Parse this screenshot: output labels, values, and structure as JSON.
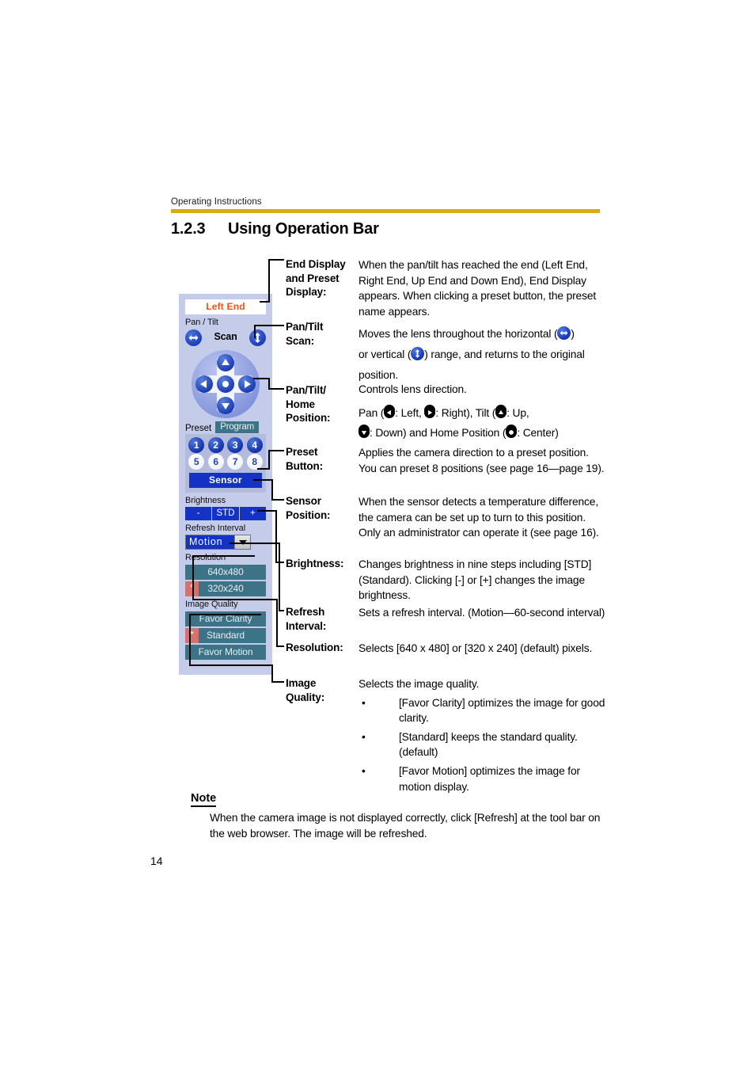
{
  "header": {
    "running_head": "Operating Instructions",
    "rule_color": "#dcaa09"
  },
  "section": {
    "number": "1.2.3",
    "title": "Using Operation Bar"
  },
  "operation_panel": {
    "end_display": {
      "value": "Left End",
      "text_color": "#e8541a"
    },
    "pan_tilt_label": "Pan / Tilt",
    "scan_label": "Scan",
    "scan_buttons": {
      "horizontal_icon": "horizontal-scan-icon",
      "vertical_icon": "vertical-scan-icon"
    },
    "dpad": {
      "up_icon": "arrow-up-icon",
      "down_icon": "arrow-down-icon",
      "left_icon": "arrow-left-icon",
      "right_icon": "arrow-right-icon",
      "home_icon": "home-center-icon"
    },
    "preset": {
      "label": "Preset",
      "program_label": "Program",
      "buttons": [
        {
          "label": "1",
          "state": "on"
        },
        {
          "label": "2",
          "state": "on"
        },
        {
          "label": "3",
          "state": "on"
        },
        {
          "label": "4",
          "state": "on"
        },
        {
          "label": "5",
          "state": "off"
        },
        {
          "label": "6",
          "state": "off"
        },
        {
          "label": "7",
          "state": "off"
        },
        {
          "label": "8",
          "state": "off"
        }
      ]
    },
    "sensor_label": "Sensor",
    "brightness": {
      "label": "Brightness",
      "minus": "-",
      "std": "STD",
      "plus": "+"
    },
    "refresh_interval": {
      "label": "Refresh Interval",
      "selected": "Motion",
      "dropdown_icon": "chevron-down-icon"
    },
    "resolution": {
      "label": "Resolution",
      "options": [
        {
          "label": "640x480",
          "selected": false
        },
        {
          "label": "320x240",
          "selected": true
        }
      ]
    },
    "image_quality": {
      "label": "Image Quality",
      "options": [
        {
          "label": "Favor Clarity",
          "selected": false
        },
        {
          "label": "Standard",
          "selected": true
        },
        {
          "label": "Favor Motion",
          "selected": false
        }
      ]
    },
    "selected_marker": "*",
    "colors": {
      "panel_bg": "#c5cce9",
      "button_blue": "#1433c4",
      "option_teal": "#3d7386",
      "marker_red": "#d4726d"
    }
  },
  "definitions": [
    {
      "term": "End Display and Preset Display:",
      "desc": "When the pan/tilt has reached the end (Left End, Right End, Up End and Down End), End Display appears. When clicking a preset button, the preset name appears."
    },
    {
      "term": "Pan/Tilt Scan:",
      "desc_part1": "Moves the lens throughout the horizontal (",
      "desc_part2": ")",
      "desc_part3": "or vertical (",
      "desc_part4": ") range, and returns to the original position."
    },
    {
      "term": "Pan/Tilt/ Home Position:",
      "line1": "Controls lens direction.",
      "line2_a": "Pan (",
      "line2_b": ": Left, ",
      "line2_c": ": Right), Tilt (",
      "line2_d": ": Up,",
      "line3_a": ": Down) and Home Position (",
      "line3_b": ": Center)"
    },
    {
      "term": "Preset Button:",
      "desc": "Applies the camera direction to a preset position. You can preset 8 positions (see page 16—page 19)."
    },
    {
      "term": "Sensor Position:",
      "desc": "When the sensor detects a temperature difference, the camera can be set up to turn to this position. Only an administrator can operate it (see page 16)."
    },
    {
      "term": "Brightness:",
      "desc": "Changes brightness in nine steps including [STD] (Standard). Clicking [-] or [+] changes the image brightness."
    },
    {
      "term": "Refresh Interval:",
      "desc": "Sets a refresh interval. (Motion—60-second interval)"
    },
    {
      "term": "Resolution:",
      "desc": "Selects [640 x 480] or [320 x 240] (default) pixels."
    },
    {
      "term": "Image Quality:",
      "desc": "Selects the image quality.",
      "bullets": [
        "[Favor Clarity] optimizes the image for good clarity.",
        "[Standard] keeps the standard quality. (default)",
        "[Favor Motion] optimizes the image for motion display."
      ]
    }
  ],
  "terms_display": {
    "t0_l1": "End Display",
    "t0_l2": "and Preset",
    "t0_l3": "Display:",
    "t1_l1": "Pan/Tilt",
    "t1_l2": "Scan:",
    "t2_l1": "Pan/Tilt/",
    "t2_l2": "Home",
    "t2_l3": "Position:",
    "t3_l1": "Preset",
    "t3_l2": "Button:",
    "t4_l1": "Sensor",
    "t4_l2": "Position:",
    "t5_l1": "Brightness:",
    "t6_l1": "Refresh",
    "t6_l2": "Interval:",
    "t7_l1": "Resolution:",
    "t8_l1": "Image",
    "t8_l2": "Quality:"
  },
  "note": {
    "title": "Note",
    "body": "When the camera image is not displayed correctly, click [Refresh] at the tool bar on the web browser. The image will be refreshed."
  },
  "page_number": "14"
}
